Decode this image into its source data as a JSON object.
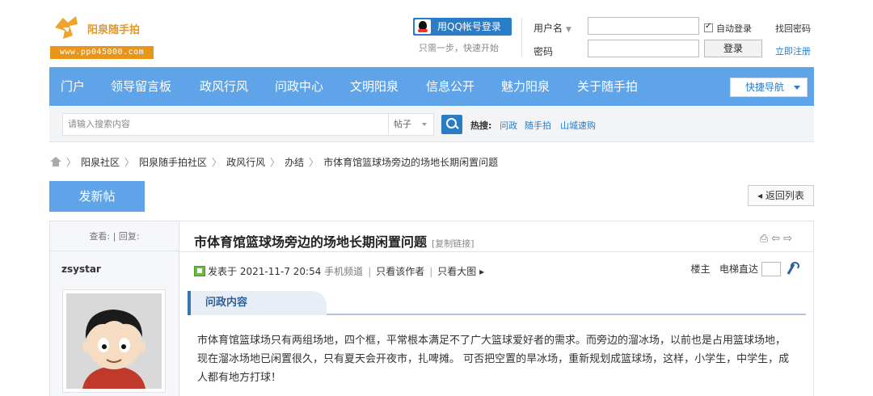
{
  "header": {
    "logo_title": "阳泉随手拍",
    "logo_url": "www.pp045000.com",
    "qq_login_label": "用QQ帐号登录",
    "qq_login_sub": "只需一步，快速开始",
    "username_label": "用户名",
    "password_label": "密码",
    "username_value": "",
    "password_value": "",
    "auto_login_label": "自动登录",
    "auto_login_checked": true,
    "login_button": "登录",
    "find_password": "找回密码",
    "register": "立即注册"
  },
  "nav": {
    "items": [
      "门户",
      "领导留言板",
      "政风行风",
      "问政中心",
      "文明阳泉",
      "信息公开",
      "魅力阳泉",
      "关于随手拍"
    ],
    "quick_nav": "快捷导航"
  },
  "search": {
    "placeholder": "请输入搜索内容",
    "type": "帖子",
    "hot_label": "热搜:",
    "hot_links": [
      "问政",
      "随手拍",
      "山城速购"
    ]
  },
  "breadcrumb": [
    "阳泉社区",
    "阳泉随手拍社区",
    "政风行风",
    "办结",
    "市体育馆篮球场旁边的场地长期闲置问题"
  ],
  "actions": {
    "new_post": "发新帖",
    "back_to_list": "◂ 返回列表"
  },
  "post": {
    "stats_label": "查看: | 回复:",
    "author": "zsystar",
    "title": "市体育馆篮球场旁边的场地长期闲置问题",
    "copy_link": "[复制链接]",
    "posted_prefix": "发表于",
    "posted_time": "2021-11-7 20:54",
    "channel": "手机频道",
    "author_only": "只看该作者",
    "view_large": "只看大图 ▸",
    "floor_label": "楼主",
    "elevator_label": "电梯直达",
    "section_title": "问政内容",
    "body": "市体育馆篮球场只有两组场地，四个框，平常根本满足不了广大篮球爱好者的需求。而旁边的溜冰场，以前也是占用篮球场地，现在溜冰场地已闲置很久，只有夏天会开夜市，扎啤摊。 可否把空置的旱冰场，重新规划成篮球场，这样，小学生，中学生，成人都有地方打球！"
  },
  "colors": {
    "nav_bg": "#5fa4e8",
    "link_blue": "#2a7cc7",
    "logo_orange": "#e8961a"
  }
}
